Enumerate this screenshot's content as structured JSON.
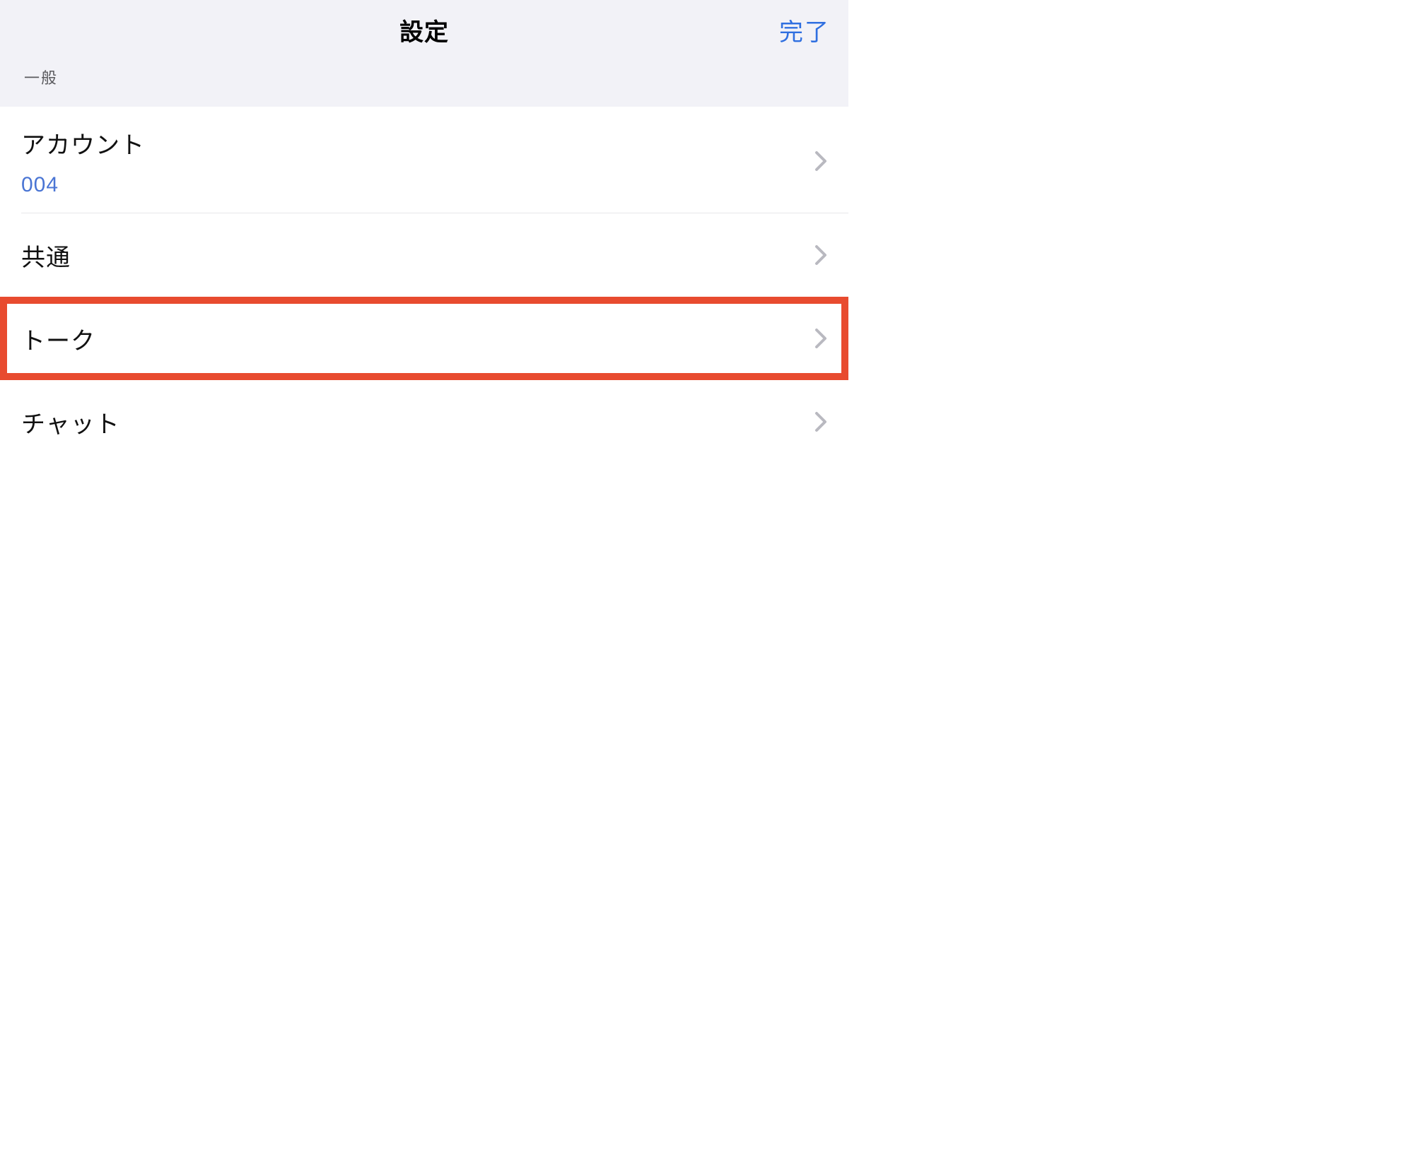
{
  "header": {
    "title": "設定",
    "done": "完了"
  },
  "section": {
    "label": "一般"
  },
  "rows": {
    "account": {
      "title": "アカウント",
      "sub": "004"
    },
    "common": {
      "title": "共通"
    },
    "talk": {
      "title": "トーク"
    },
    "chat": {
      "title": "チャット"
    }
  },
  "colors": {
    "link": "#2f6fe0",
    "highlight": "#e84b2f"
  }
}
